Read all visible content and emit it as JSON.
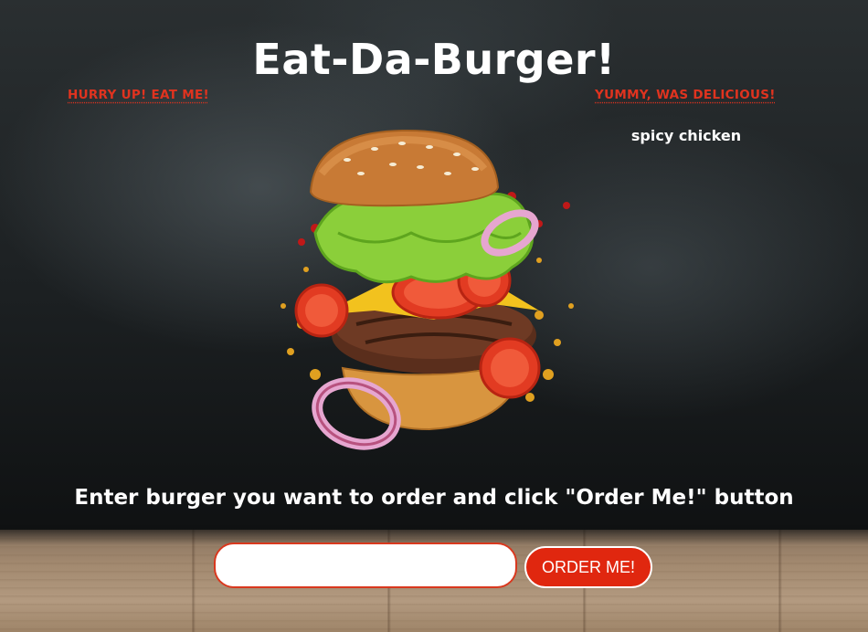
{
  "header": {
    "title": "Eat-Da-Burger!"
  },
  "columns": {
    "uneaten_heading": "HURRY UP! EAT ME!",
    "eaten_heading": "YUMMY, WAS DELICIOUS!",
    "uneaten_burgers": [],
    "eaten_burgers": [
      "spicy chicken"
    ]
  },
  "order": {
    "instructions": "Enter burger you want to order and click \"Order Me!\" button",
    "input_value": "",
    "button_label": "ORDER ME!"
  },
  "colors": {
    "accent_red": "#e0331f",
    "button_red": "#e0270f",
    "text_white": "#ffffff"
  },
  "icons": {
    "hero_image": "flying-burger-illustration"
  }
}
